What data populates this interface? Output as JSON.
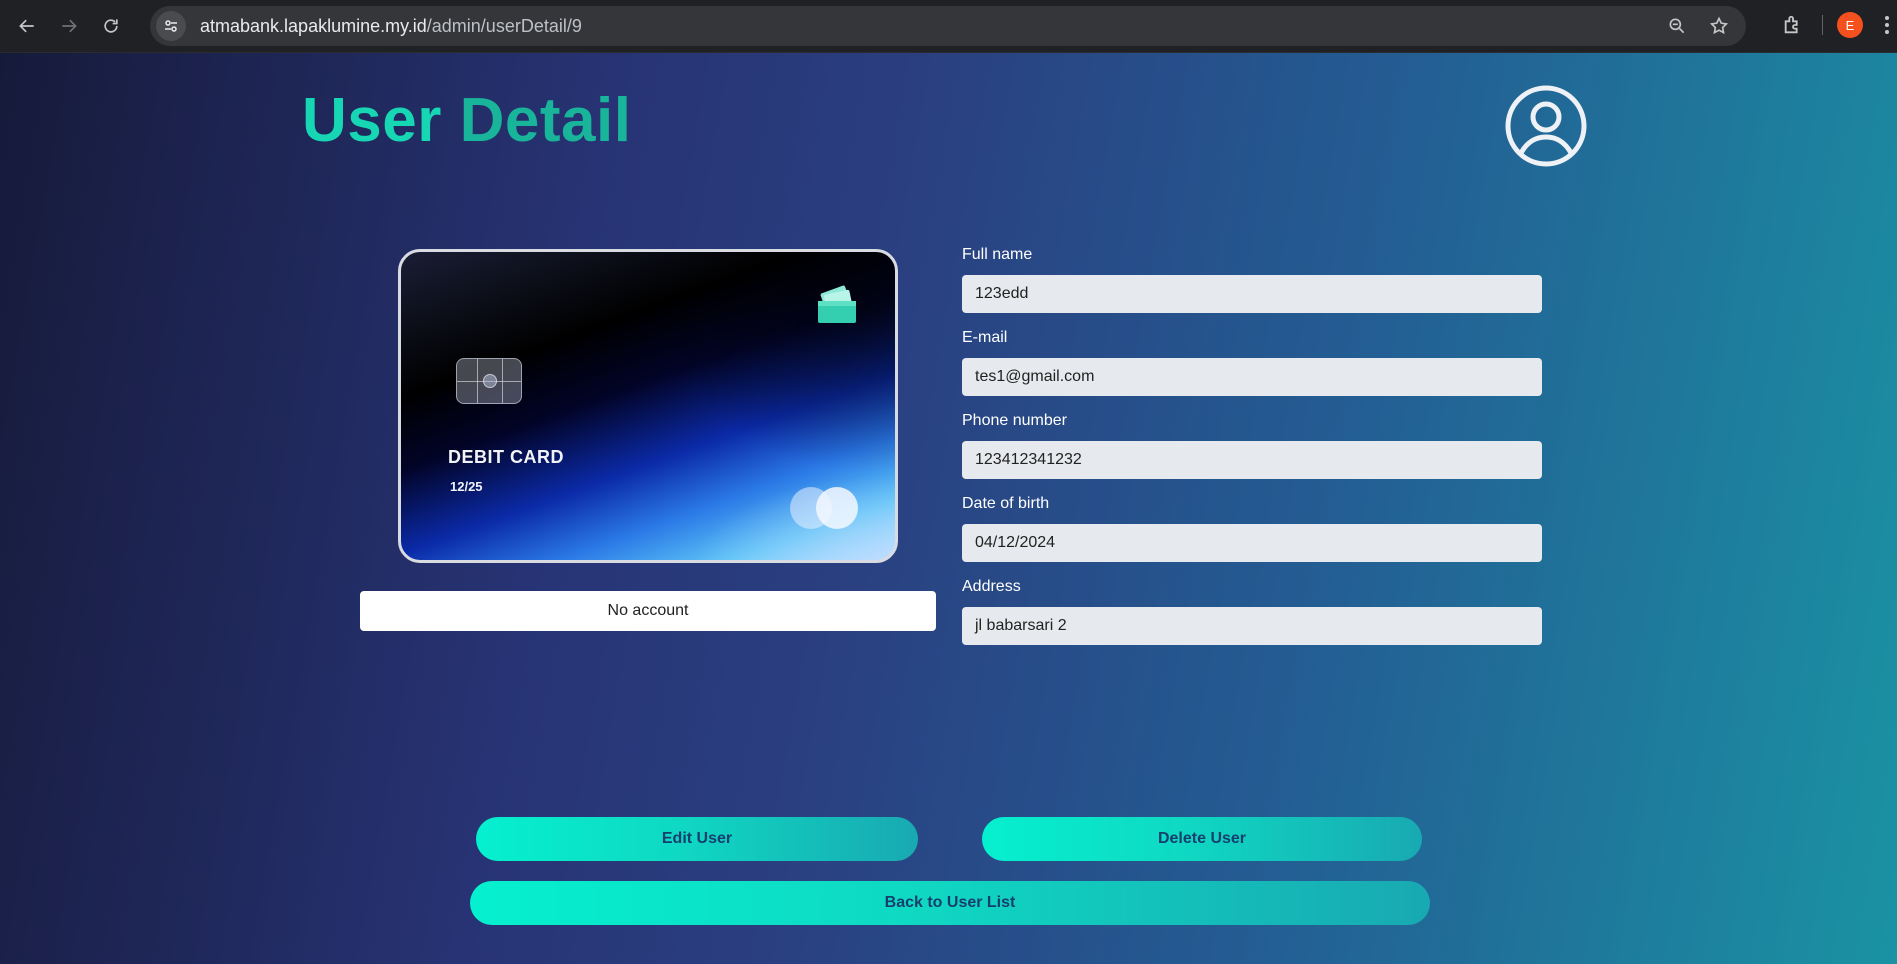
{
  "browser": {
    "url_host": "atmabank.lapaklumine.my.id",
    "url_path": "/admin/userDetail/9",
    "profile_initial": "E"
  },
  "header": {
    "title_word1": "User",
    "title_word2": "Detail"
  },
  "card": {
    "type_label": "DEBIT CARD",
    "expiry": "12/25",
    "account_status": "No account"
  },
  "form": {
    "full_name_label": "Full name",
    "full_name_value": "123edd",
    "email_label": "E-mail",
    "email_value": "tes1@gmail.com",
    "phone_label": "Phone number",
    "phone_value": "123412341232",
    "dob_label": "Date of birth",
    "dob_value": "04/12/2024",
    "address_label": "Address",
    "address_value": "jl babarsari 2"
  },
  "actions": {
    "edit_label": "Edit User",
    "delete_label": "Delete User",
    "back_label": "Back to User List"
  },
  "colors": {
    "title_primary": "#17d6b4",
    "button_gradient_start": "#05f0cf",
    "button_text": "#15406e"
  }
}
